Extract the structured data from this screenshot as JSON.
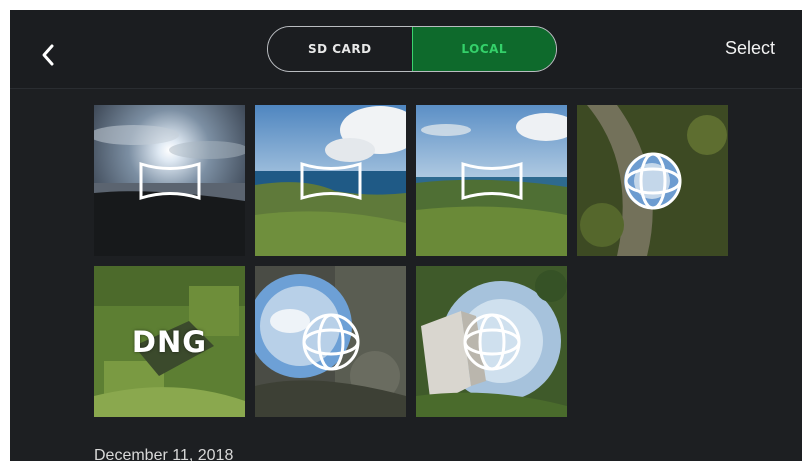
{
  "header": {
    "back_icon": "chevron-left-icon",
    "tabs": [
      {
        "label": "SD CARD",
        "selected": false
      },
      {
        "label": "LOCAL",
        "selected": true
      }
    ],
    "select_label": "Select"
  },
  "colors": {
    "background": "#1d1f22",
    "accent_green": "#34d16a",
    "accent_green_bg": "#0e6a2c"
  },
  "gallery": {
    "items": [
      {
        "type": "panorama",
        "icon": "panorama-icon"
      },
      {
        "type": "panorama",
        "icon": "panorama-icon"
      },
      {
        "type": "panorama",
        "icon": "panorama-icon"
      },
      {
        "type": "sphere",
        "icon": "sphere-icon"
      },
      {
        "type": "dng",
        "label": "DNG"
      },
      {
        "type": "sphere",
        "icon": "sphere-icon"
      },
      {
        "type": "sphere",
        "icon": "sphere-icon"
      }
    ],
    "next_section_date": "December 11, 2018"
  }
}
